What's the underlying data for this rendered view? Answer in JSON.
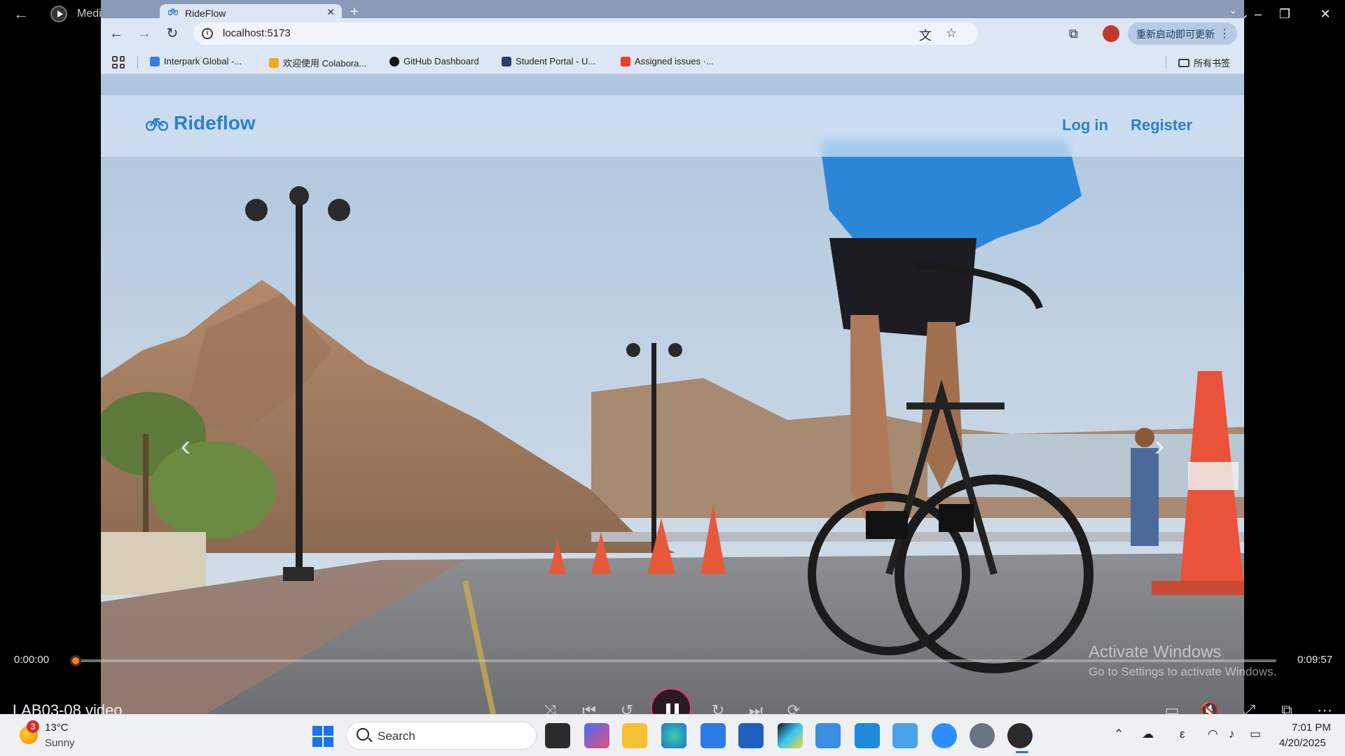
{
  "media_player": {
    "app_title": "Media Player",
    "video_title": "LAB03-08 video",
    "time_current": "0:00:00",
    "time_total": "0:09:57",
    "progress": 0.0
  },
  "browser": {
    "tab_title": "RideFlow",
    "url": "localhost:5173",
    "update_button": "重新启动即可更新",
    "bookmarks": [
      {
        "label": "Interpark Global -..."
      },
      {
        "label": "欢迎使用 Colabora..."
      },
      {
        "label": "GitHub Dashboard"
      },
      {
        "label": "Student Portal - U..."
      },
      {
        "label": "Assigned issues ·..."
      }
    ],
    "all_bookmarks": "所有书签"
  },
  "app": {
    "brand": "Rideflow",
    "brand_color": "#2d7fd3",
    "nav": {
      "login": "Log in",
      "register": "Register"
    }
  },
  "watermark": {
    "line1": "Activate Windows",
    "line2": "Go to Settings to activate Windows."
  },
  "taskbar": {
    "weather_badge": "3",
    "temperature": "13°C",
    "condition": "Sunny",
    "search_placeholder": "Search",
    "time": "7:01 PM",
    "date": "4/20/2025",
    "lang": "ε"
  }
}
